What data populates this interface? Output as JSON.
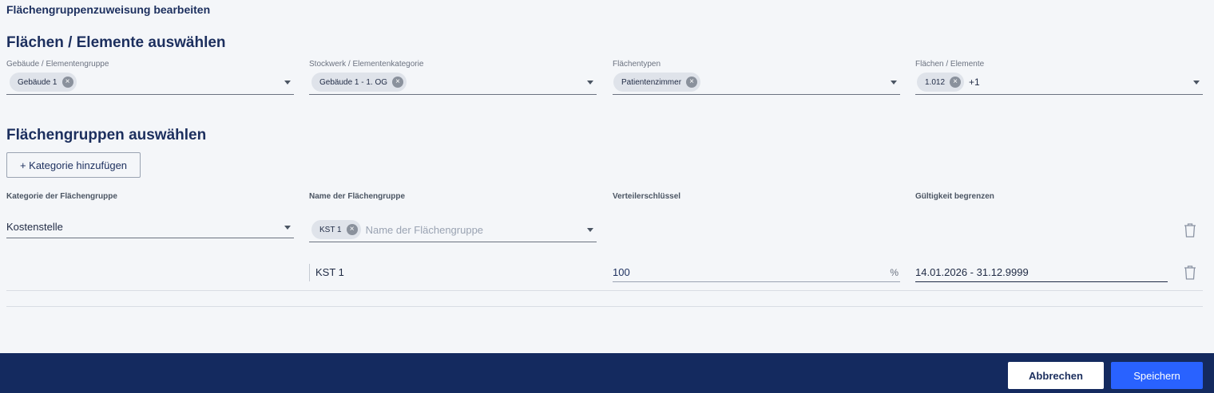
{
  "page": {
    "title": "Flächengruppenzuweisung bearbeiten"
  },
  "section1": {
    "title": "Flächen / Elemente auswählen",
    "fields": [
      {
        "label": "Gebäude / Elementengruppe",
        "chips": [
          "Gebäude 1"
        ],
        "more": ""
      },
      {
        "label": "Stockwerk / Elementenkategorie",
        "chips": [
          "Gebäude 1 - 1. OG"
        ],
        "more": ""
      },
      {
        "label": "Flächentypen",
        "chips": [
          "Patientenzimmer"
        ],
        "more": ""
      },
      {
        "label": "Flächen / Elemente",
        "chips": [
          "1.012"
        ],
        "more": "+1"
      }
    ]
  },
  "section2": {
    "title": "Flächengruppen auswählen",
    "add_button": "+ Kategorie hinzufügen",
    "columns": [
      "Kategorie der Flächengruppe",
      "Name der Flächengruppe",
      "Verteilerschlüssel",
      "Gültigkeit begrenzen"
    ],
    "row1": {
      "category": "Kostenstelle",
      "name_chip": "KST 1",
      "name_placeholder": "Name der Flächengruppe"
    },
    "row2": {
      "name": "KST 1",
      "key_value": "100",
      "unit": "%",
      "validity": "14.01.2026 - 31.12.9999"
    }
  },
  "footer": {
    "cancel": "Abbrechen",
    "save": "Speichern"
  },
  "colors": {
    "primary": "#2962ff",
    "footer_bg": "#142a5f",
    "heading": "#1c2f5e"
  }
}
